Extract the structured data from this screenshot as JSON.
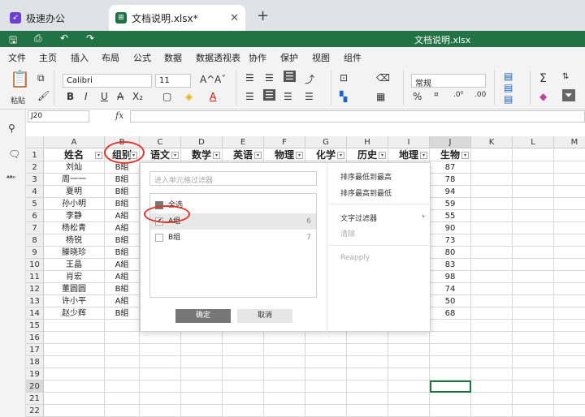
{
  "tabs": [
    {
      "label": "极速办公"
    },
    {
      "label": "文档说明.xlsx*"
    }
  ],
  "new_tab_symbol": "+",
  "close_symbol": "✕",
  "document_title": "文档说明.xlsx",
  "menu": [
    "文件",
    "主页",
    "插入",
    "布局",
    "公式",
    "数据",
    "数据透视表",
    "协作",
    "保护",
    "视图",
    "组件"
  ],
  "ribbon": {
    "paste_label": "粘贴",
    "font_name": "Calibri",
    "font_size": "11",
    "number_format": "常规",
    "bold": "B",
    "italic": "I",
    "underline": "U",
    "strike": "A",
    "subscript": "X₂",
    "grow": "A^",
    "shrink": "Aˇ",
    "percent": "%",
    "sum": "Σ"
  },
  "formula_bar": {
    "cell_ref": "J20",
    "fx": "fx"
  },
  "columns": [
    "A",
    "B",
    "C",
    "D",
    "E",
    "F",
    "G",
    "H",
    "I",
    "J",
    "K",
    "L",
    "M"
  ],
  "header_row": [
    "姓名",
    "组别",
    "语文",
    "数学",
    "英语",
    "物理",
    "化学",
    "历史",
    "地理",
    "生物"
  ],
  "rows": [
    {
      "name": "刘灿",
      "group": "B組",
      "bio": "87"
    },
    {
      "name": "周一一",
      "group": "B組",
      "bio": "78"
    },
    {
      "name": "夏明",
      "group": "B組",
      "bio": "94"
    },
    {
      "name": "孙小明",
      "group": "B組",
      "bio": "59"
    },
    {
      "name": "李静",
      "group": "A組",
      "bio": "55"
    },
    {
      "name": "杨松青",
      "group": "A組",
      "bio": "90"
    },
    {
      "name": "杨锐",
      "group": "B組",
      "bio": "73"
    },
    {
      "name": "滕晓珍",
      "group": "B組",
      "bio": "80"
    },
    {
      "name": "王晶",
      "group": "A組",
      "bio": "83"
    },
    {
      "name": "肖宏",
      "group": "A組",
      "bio": "98"
    },
    {
      "name": "董圆圆",
      "group": "B組",
      "bio": "74"
    },
    {
      "name": "许小平",
      "group": "A組",
      "bio": "50"
    },
    {
      "name": "赵少辉",
      "group": "B組",
      "bio": "68"
    }
  ],
  "row_numbers": [
    "1",
    "2",
    "3",
    "4",
    "5",
    "6",
    "7",
    "8",
    "9",
    "10",
    "11",
    "12",
    "13",
    "14",
    "15",
    "16",
    "17",
    "18",
    "19",
    "20",
    "21",
    "22"
  ],
  "filter_popup": {
    "search_placeholder": "进入单元格过滤器",
    "select_all": "全选",
    "items": [
      {
        "label": "A组",
        "count": "6",
        "checked": true
      },
      {
        "label": "B组",
        "count": "7",
        "checked": false
      }
    ],
    "ok": "确定",
    "cancel": "取消",
    "sort_asc": "排序最低到最高",
    "sort_desc": "排序最高到最低",
    "text_filter": "文字过滤器",
    "clear": "清除",
    "reapply": "Reapply"
  },
  "accent_color": "#217346",
  "annotation_color": "#e2352b"
}
